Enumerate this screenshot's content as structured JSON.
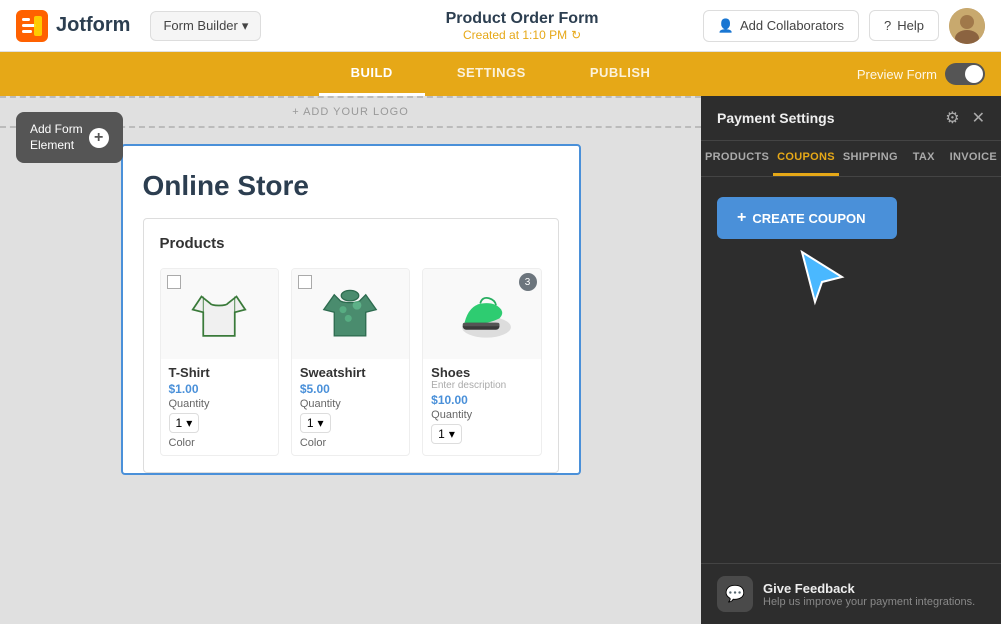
{
  "navbar": {
    "logo_text": "Jotform",
    "form_builder_label": "Form Builder",
    "form_title": "Product Order Form",
    "form_subtitle": "Created at 1:10 PM",
    "add_collab_label": "Add Collaborators",
    "help_label": "Help"
  },
  "tabs": {
    "build": "BUILD",
    "settings": "SETTINGS",
    "publish": "PUBLISH",
    "preview_form": "Preview Form"
  },
  "add_form_element": {
    "label": "Add Form\nElement"
  },
  "canvas": {
    "add_logo_text": "+ ADD YOUR LOGO",
    "store_title": "Online Store",
    "products_label": "Products"
  },
  "products": [
    {
      "name": "T-Shirt",
      "price": "$1.00",
      "qty_label": "Quantity",
      "qty_default": "1",
      "color_label": "Color",
      "type": "tshirt"
    },
    {
      "name": "Sweatshirt",
      "price": "$5.00",
      "qty_label": "Quantity",
      "qty_default": "1",
      "color_label": "Color",
      "type": "sweatshirt"
    },
    {
      "name": "Shoes",
      "price": "$10.00",
      "qty_label": "Quantity",
      "qty_default": "1",
      "desc": "Enter description",
      "type": "shoes",
      "badge": "3"
    }
  ],
  "payment_panel": {
    "title": "Payment Settings",
    "tabs": [
      "PRODUCTS",
      "COUPONS",
      "SHIPPING",
      "TAX",
      "INVOICE"
    ],
    "active_tab": "COUPONS",
    "create_coupon_label": "CREATE COUPON"
  },
  "feedback": {
    "title": "Give Feedback",
    "subtitle": "Help us improve your payment integrations."
  }
}
